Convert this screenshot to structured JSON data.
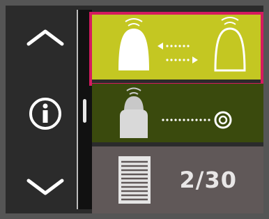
{
  "nav": {
    "up_icon": "chevron-up-icon",
    "info_icon": "info-icon",
    "down_icon": "chevron-down-icon"
  },
  "list": {
    "items": [
      {
        "name": "swap-shape-item",
        "selected": true,
        "color": "#c4c722"
      },
      {
        "name": "target-shape-item",
        "selected": false,
        "color": "#3a4a0d"
      },
      {
        "name": "page-item",
        "selected": false,
        "color": "#605858"
      }
    ],
    "page_counter": "2/30"
  },
  "colors": {
    "selection_border": "#d41a5f",
    "background": "#2b2b2b"
  }
}
